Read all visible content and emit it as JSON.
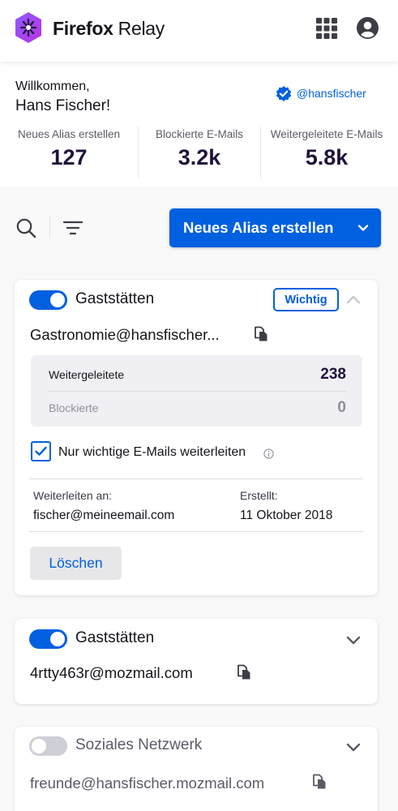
{
  "header": {
    "brand_bold": "Firefox",
    "brand_rest": " Relay",
    "apps_icon": "grid-icon",
    "account_icon": "user-circle-icon"
  },
  "profile": {
    "welcome": "Willkommen,",
    "name": "Hans Fischer!",
    "handle": "@hansfischer",
    "stats": [
      {
        "label": "Neues Alias erstellen",
        "value": "127"
      },
      {
        "label": "Blockierte E-Mails",
        "value": "3.2k"
      },
      {
        "label": "Weitergeleitete E-Mails",
        "value": "5.8k"
      }
    ]
  },
  "toolbar": {
    "new_alias_label": "Neues Alias erstellen"
  },
  "aliases": [
    {
      "enabled": true,
      "label": "Gaststätten",
      "badge": "Wichtig",
      "expanded": true,
      "address": "Gastronomie@hansfischer...",
      "forwarded_label": "Weitergeleitete",
      "forwarded_value": "238",
      "blocked_label": "Blockierte",
      "blocked_value": "0",
      "important_only_label": "Nur wichtige E-Mails weiterleiten",
      "important_only_checked": true,
      "forward_to_label": "Weiterleiten an:",
      "forward_to_value": "fischer@meineemail.com",
      "created_label": "Erstellt:",
      "created_value": "11 Oktober 2018",
      "delete_label": "Löschen"
    },
    {
      "enabled": true,
      "label": "Gaststätten",
      "expanded": false,
      "address": "4rtty463r@mozmail.com"
    },
    {
      "enabled": false,
      "label": "Soziales Netzwerk",
      "expanded": false,
      "address": "freunde@hansfischer.mozmail.com"
    }
  ],
  "colors": {
    "accent": "#0060df",
    "stat_value": "#20123a",
    "background": "#f9f9fa"
  }
}
